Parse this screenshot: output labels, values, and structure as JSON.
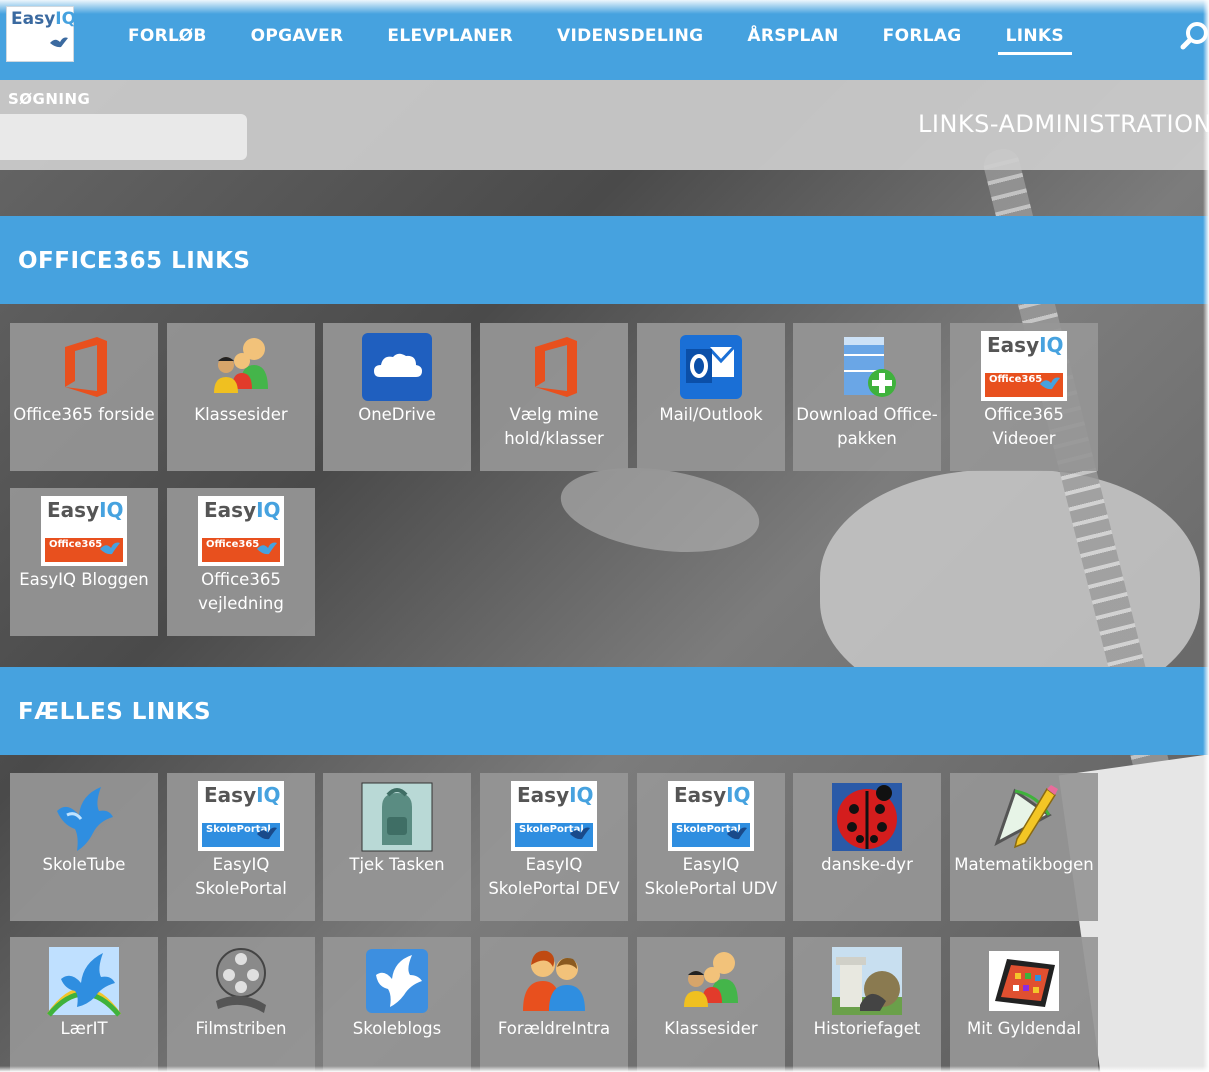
{
  "nav": {
    "logo": "EasyIQ",
    "items": [
      {
        "label": "FORLØB"
      },
      {
        "label": "OPGAVER"
      },
      {
        "label": "ELEVPLANER"
      },
      {
        "label": "VIDENSDELING"
      },
      {
        "label": "ÅRSPLAN"
      },
      {
        "label": "FORLAG"
      },
      {
        "label": "LINKS",
        "active": true
      }
    ]
  },
  "search": {
    "label": "SØGNING",
    "value": "",
    "placeholder": ""
  },
  "admin_title": "LINKS-ADMINISTRATION",
  "sections": [
    {
      "title": "OFFICE365 LINKS",
      "tiles": [
        {
          "label": "Office365 forside",
          "icon": "office365-icon"
        },
        {
          "label": "Klassesider",
          "icon": "group-people-icon"
        },
        {
          "label": "OneDrive",
          "icon": "onedrive-icon"
        },
        {
          "label": "Vælg mine hold/klasser",
          "icon": "office365-icon"
        },
        {
          "label": "Mail/Outlook",
          "icon": "outlook-icon"
        },
        {
          "label": "Download Office-pakken",
          "icon": "download-package-icon"
        },
        {
          "label": "Office365 Videoer",
          "icon": "easyiq-office365-video-icon"
        },
        {
          "label": "EasyIQ Bloggen",
          "icon": "easyiq-office365-icon"
        },
        {
          "label": "Office365 vejledning",
          "icon": "easyiq-office365-icon"
        }
      ]
    },
    {
      "title": "FÆLLES LINKS",
      "tiles": [
        {
          "label": "SkoleTube",
          "icon": "bluebird-icon"
        },
        {
          "label": "EasyIQ SkolePortal",
          "icon": "easyiq-skoleportal-icon"
        },
        {
          "label": "Tjek Tasken",
          "icon": "backpack-icon"
        },
        {
          "label": "EasyIQ SkolePortal DEV",
          "icon": "easyiq-skoleportal-icon"
        },
        {
          "label": "EasyIQ SkolePortal UDV",
          "icon": "easyiq-skoleportal-icon"
        },
        {
          "label": "danske-dyr",
          "icon": "ladybug-icon"
        },
        {
          "label": "Matematikbogen",
          "icon": "protractor-pencil-icon"
        },
        {
          "label": "LærIT",
          "icon": "bluebird-rainbow-icon"
        },
        {
          "label": "Filmstriben",
          "icon": "film-reel-icon"
        },
        {
          "label": "Skoleblogs",
          "icon": "white-bird-icon"
        },
        {
          "label": "ForældreIntra",
          "icon": "parents-icon"
        },
        {
          "label": "Klassesider",
          "icon": "group-people-icon"
        },
        {
          "label": "Historiefaget",
          "icon": "history-column-icon"
        },
        {
          "label": "Mit Gyldendal",
          "icon": "tablet-icon"
        }
      ]
    }
  ],
  "easyiq_badge": {
    "easy": "Easy",
    "iq": "IQ",
    "office": "Office365",
    "portal": "SkolePortal"
  },
  "colors": {
    "accent": "#46a2df",
    "tile": "#969696",
    "office_orange": "#e8501e"
  }
}
